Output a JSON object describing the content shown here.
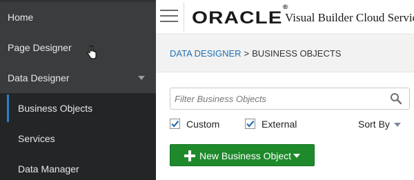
{
  "sidebar": {
    "items": [
      {
        "label": "Home"
      },
      {
        "label": "Page Designer"
      },
      {
        "label": "Data Designer"
      },
      {
        "label": "Business Objects"
      },
      {
        "label": "Services"
      },
      {
        "label": "Data Manager"
      }
    ]
  },
  "header": {
    "logo_text": "ORACLE",
    "logo_mark": "®",
    "app_name": "Visual Builder Cloud Service"
  },
  "breadcrumb": {
    "parent": "DATA DESIGNER",
    "separator": ">",
    "current": "BUSINESS OBJECTS"
  },
  "filter": {
    "placeholder": "Filter Business Objects",
    "value": ""
  },
  "options": {
    "custom_label": "Custom",
    "custom_checked": true,
    "external_label": "External",
    "external_checked": true,
    "sort_label": "Sort By"
  },
  "actions": {
    "new_label": "New Business Object"
  },
  "colors": {
    "accent_green": "#1e8a2b",
    "link_blue": "#1f6fb0",
    "sidebar_bg": "#2f3133",
    "active_indicator": "#2d7fc9"
  }
}
